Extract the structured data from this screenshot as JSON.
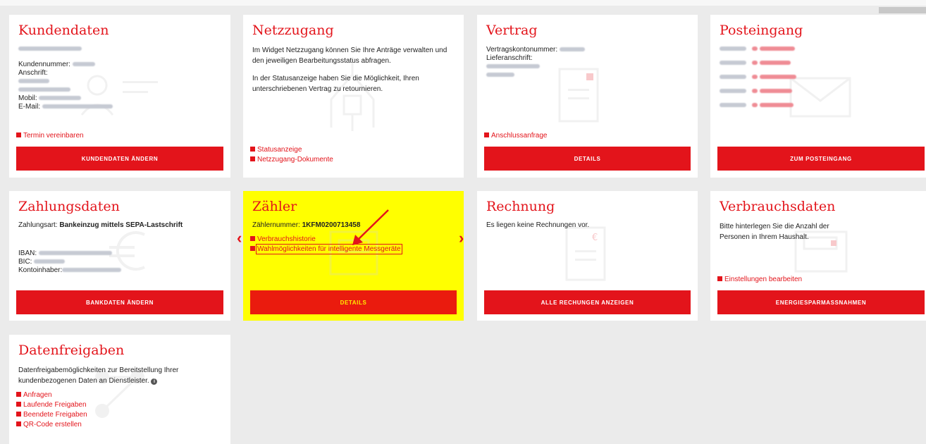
{
  "kundendaten": {
    "title": "Kundendaten",
    "kundennummer_label": "Kundennummer:",
    "anschrift_label": "Anschrift:",
    "mobil_label": "Mobil:",
    "email_label": "E-Mail:",
    "link_termin": "Termin vereinbaren",
    "button": "KUNDENDATEN ÄNDERN"
  },
  "netzzugang": {
    "title": "Netzzugang",
    "text1": "Im Widget Netzzugang können Sie Ihre Anträge verwalten und den jeweiligen Bearbeitungsstatus abfragen.",
    "text2": "In der Statusanzeige haben Sie die Möglichkeit, Ihren unterschriebenen Vertrag zu retournieren.",
    "link_status": "Statusanzeige",
    "link_dokumente": "Netzzugang-Dokumente"
  },
  "vertrag": {
    "title": "Vertrag",
    "konto_label": "Vertragskontonummer:",
    "liefer_label": "Lieferanschrift:",
    "link_anschluss": "Anschlussanfrage",
    "button": "DETAILS"
  },
  "posteingang": {
    "title": "Posteingang",
    "button": "ZUM POSTEINGANG"
  },
  "zahlungsdaten": {
    "title": "Zahlungsdaten",
    "zahlungsart_label": "Zahlungsart:",
    "zahlungsart_value": "Bankeinzug mittels SEPA-Lastschrift",
    "iban_label": "IBAN:",
    "bic_label": "BIC:",
    "inhaber_label": "Kontoinhaber:",
    "button": "BANKDATEN ÄNDERN"
  },
  "zaehler": {
    "title": "Zähler",
    "nummer_label": "Zählernummer:",
    "nummer_value": "1KFM0200713458",
    "link_historie": "Verbrauchshistorie",
    "link_messgeraete": "Wahlmöglichkeiten für intelligente Messgeräte",
    "button": "DETAILS",
    "arrow_left": "‹",
    "arrow_right": "›"
  },
  "rechnung": {
    "title": "Rechnung",
    "text": "Es liegen keine Rechnungen vor.",
    "button": "ALLE RECHUNGEN ANZEIGEN"
  },
  "verbrauchsdaten": {
    "title": "Verbrauchsdaten",
    "text": "Bitte hinterlegen Sie die Anzahl der Personen in Ihrem Haushalt.",
    "link_einstellungen": "Einstellungen bearbeiten",
    "button": "ENERGIESPARMASSNAHMEN"
  },
  "datenfreigaben": {
    "title": "Datenfreigaben",
    "text": "Datenfreigabemöglichkeiten zur Bereitstellung Ihrer kundenbezogenen Daten an Dienstleister.",
    "info_glyph": "i",
    "links": [
      "Anfragen",
      "Laufende Freigaben",
      "Beendete Freigaben",
      "QR-Code erstellen"
    ]
  },
  "colors": {
    "brand_red": "#e3141b",
    "highlight_yellow": "#ffff00",
    "background": "#ebebeb"
  }
}
